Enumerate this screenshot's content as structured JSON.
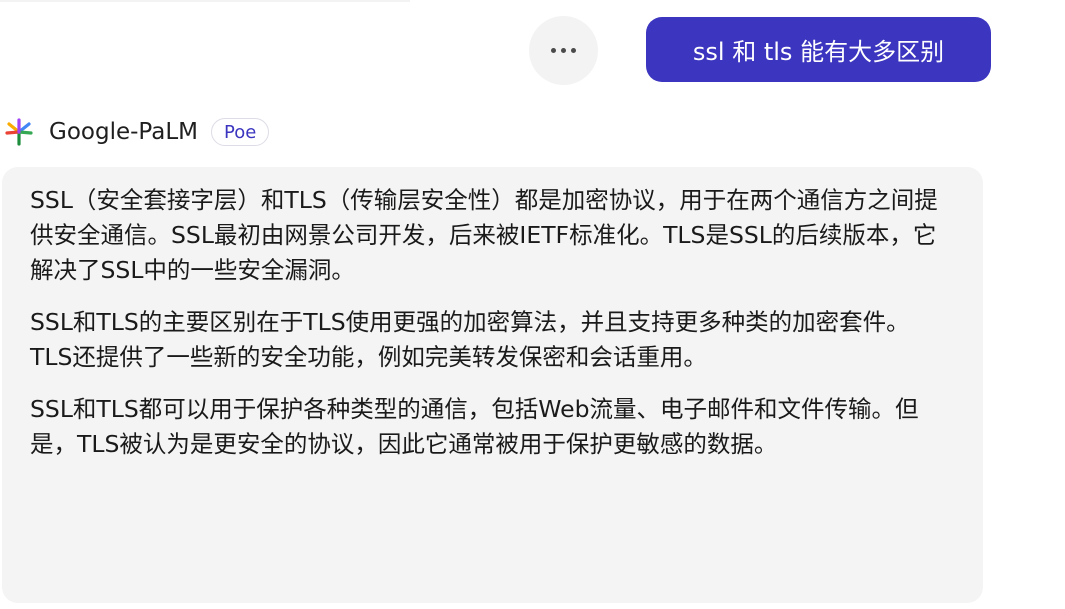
{
  "conversation": {
    "user_message": "ssl 和 tls 能有大多区别",
    "more_button_icon": "more-horizontal-icon",
    "bot": {
      "name": "Google-PaLM",
      "badge": "Poe",
      "avatar_icon": "google-palm-logo-icon",
      "paragraphs": [
        "SSL（安全套接字层）和TLS（传输层安全性）都是加密协议，用于在两个通信方之间提供安全通信。SSL最初由网景公司开发，后来被IETF标准化。TLS是SSL的后续版本，它解决了SSL中的一些安全漏洞。",
        "SSL和TLS的主要区别在于TLS使用更强的加密算法，并且支持更多种类的加密套件。TLS还提供了一些新的安全功能，例如完美转发保密和会话重用。",
        "SSL和TLS都可以用于保护各种类型的通信，包括Web流量、电子邮件和文件传输。但是，TLS被认为是更安全的协议，因此它通常被用于保护更敏感的数据。"
      ]
    }
  },
  "colors": {
    "user_bubble": "#3b35bf",
    "bot_bubble": "#f4f4f5",
    "badge_text": "#3b35bf"
  }
}
